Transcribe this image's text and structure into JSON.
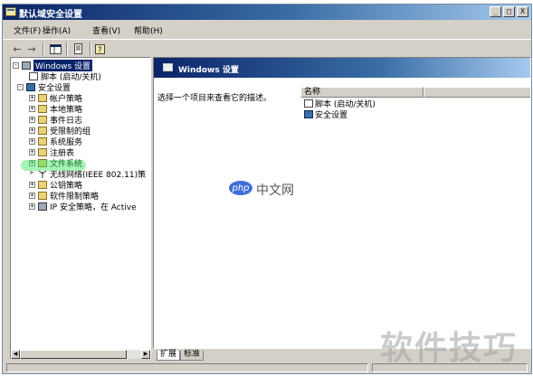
{
  "window": {
    "title": "默认域安全设置",
    "controls": {
      "minimize": "_",
      "maximize": "□",
      "close": "X"
    }
  },
  "menu": {
    "items": [
      "文件(F)",
      "操作(A)",
      "查看(V)",
      "帮助(H)"
    ]
  },
  "toolbar": {
    "back": "←",
    "forward": "→"
  },
  "tree": {
    "items": [
      {
        "label": "Windows 设置",
        "sign": "-",
        "icon": "computer-icon"
      },
      {
        "label": "脚本 (启动/关机)",
        "sign": "",
        "icon": "document-icon"
      },
      {
        "label": "安全设置",
        "sign": "-",
        "icon": "security-icon"
      },
      {
        "label": "帐户策略",
        "sign": "+",
        "icon": "folder-icon"
      },
      {
        "label": "本地策略",
        "sign": "+",
        "icon": "folder-icon"
      },
      {
        "label": "事件日志",
        "sign": "+",
        "icon": "folder-icon"
      },
      {
        "label": "受限制的组",
        "sign": "+",
        "icon": "folder-icon"
      },
      {
        "label": "系统服务",
        "sign": "+",
        "icon": "folder-icon"
      },
      {
        "label": "注册表",
        "sign": "+",
        "icon": "folder-icon"
      },
      {
        "label": "文件系统",
        "sign": "+",
        "icon": "folder-icon"
      },
      {
        "label": "无线网络(IEEE 802.11)策",
        "sign": "",
        "icon": "antenna-icon"
      },
      {
        "label": "公钥策略",
        "sign": "+",
        "icon": "folder-icon"
      },
      {
        "label": "软件限制策略",
        "sign": "+",
        "icon": "folder-icon"
      },
      {
        "label": "IP 安全策略，在 Active",
        "sign": "+",
        "icon": "ip-security-icon"
      }
    ]
  },
  "details": {
    "header": "Windows 设置",
    "description": "选择一个项目来查看它的描述。",
    "column_name": "名称",
    "items": [
      "脚本 (启动/关机)",
      "安全设置"
    ]
  },
  "tabs": [
    "扩展",
    "标准"
  ],
  "watermarks": {
    "php": "php",
    "php_cn": "中文网",
    "site": "软件技巧"
  }
}
